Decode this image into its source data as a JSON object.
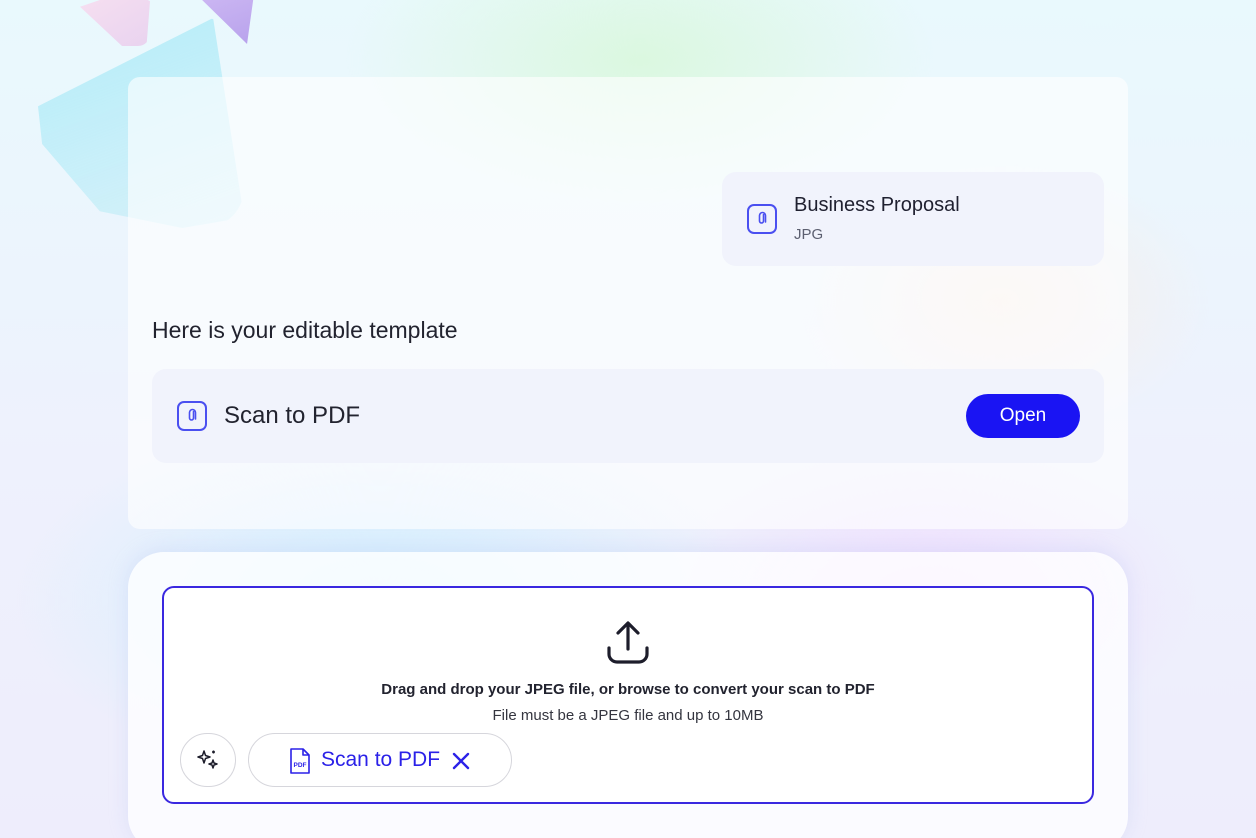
{
  "attachment": {
    "title": "Business Proposal",
    "type": "JPG",
    "icon": "paperclip-icon"
  },
  "assistant": {
    "message": "Here is your editable template"
  },
  "template": {
    "title": "Scan to PDF",
    "icon": "paperclip-icon",
    "open_label": "Open"
  },
  "dropzone": {
    "icon": "upload-icon",
    "title": "Drag and drop your JPEG file, or browse to convert your scan to PDF",
    "subtitle": "File must be a JPEG file and up to 10MB"
  },
  "toolbar": {
    "sparkle_icon": "sparkle-icon",
    "tool_label": "Scan to PDF",
    "tool_icon": "pdf-file-icon",
    "remove_icon": "close-icon"
  },
  "colors": {
    "accent": "#1a14f3",
    "icon_accent": "#4a4ff0",
    "dropzone_border": "#3a28e0"
  }
}
